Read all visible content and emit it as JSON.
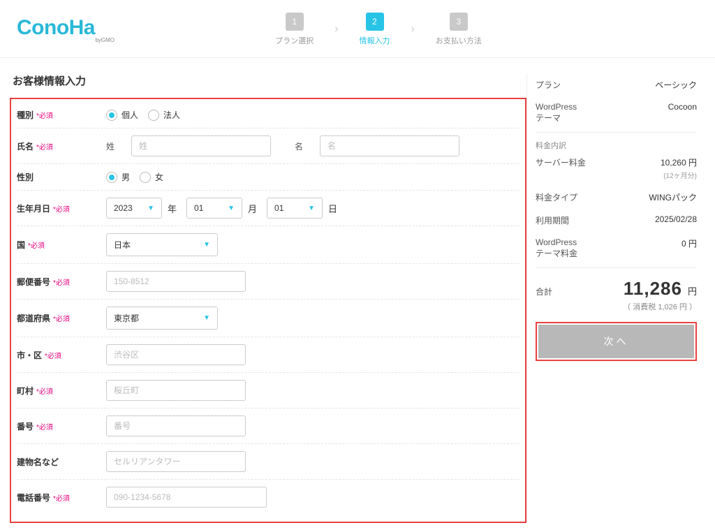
{
  "logo": {
    "main": "ConoHa",
    "sub": "byGMO"
  },
  "steps": {
    "s1": {
      "num": "1",
      "label": "プラン選択"
    },
    "s2": {
      "num": "2",
      "label": "情報入力"
    },
    "s3": {
      "num": "3",
      "label": "お支払い方法"
    }
  },
  "title": "お客様情報入力",
  "req": "*必須",
  "form": {
    "type": {
      "label": "種別",
      "opt1": "個人",
      "opt2": "法人"
    },
    "name": {
      "label": "氏名",
      "sub1": "姓",
      "ph1": "姓",
      "sub2": "名",
      "ph2": "名"
    },
    "gender": {
      "label": "性別",
      "opt1": "男",
      "opt2": "女"
    },
    "dob": {
      "label": "生年月日",
      "year": "2023",
      "y": "年",
      "month": "01",
      "m": "月",
      "day": "01",
      "d": "日"
    },
    "country": {
      "label": "国",
      "value": "日本"
    },
    "postal": {
      "label": "郵便番号",
      "ph": "150-8512"
    },
    "pref": {
      "label": "都道府県",
      "value": "東京都"
    },
    "city": {
      "label": "市・区",
      "ph": "渋谷区"
    },
    "town": {
      "label": "町村",
      "ph": "桜丘町"
    },
    "num": {
      "label": "番号",
      "ph": "番号"
    },
    "bldg": {
      "label": "建物名など",
      "ph": "セルリアンタワー"
    },
    "tel": {
      "label": "電話番号",
      "ph": "090-1234-5678"
    }
  },
  "summary": {
    "plan": {
      "k": "プラン",
      "v": "ベーシック"
    },
    "theme": {
      "k": "WordPress\nテーマ",
      "v": "Cocoon"
    },
    "breakdown": "料金内訳",
    "server": {
      "k": "サーバー料金",
      "v": "10,260 円",
      "sub": "(12ヶ月分)"
    },
    "feetype": {
      "k": "料金タイプ",
      "v": "WINGパック"
    },
    "period": {
      "k": "利用期間",
      "v": "2025/02/28"
    },
    "themefee": {
      "k": "WordPress\nテーマ料金",
      "v": "0 円"
    },
    "total": {
      "label": "合計",
      "amount": "11,286",
      "yen": "円"
    },
    "tax": "（ 消費税 1,026 円 ）",
    "next": "次へ"
  }
}
